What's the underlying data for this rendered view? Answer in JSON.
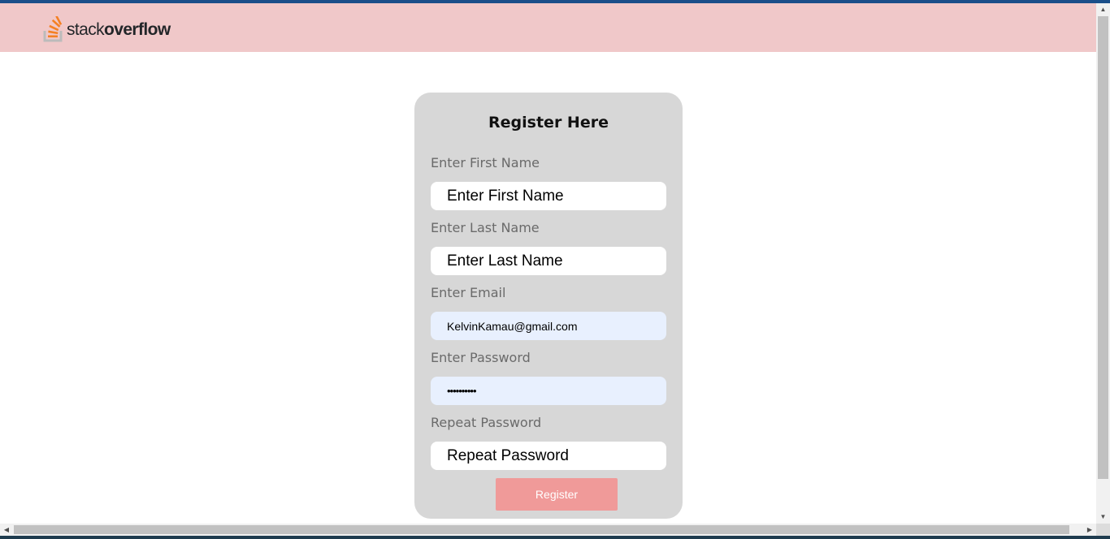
{
  "navbar": {
    "logo_text_part1": "stack",
    "logo_text_part2": "overflow",
    "logo_icon": "stackoverflow-logo-icon"
  },
  "form": {
    "title": "Register Here",
    "first_name": {
      "label": "Enter First Name",
      "placeholder": "Enter First Name",
      "value": ""
    },
    "last_name": {
      "label": "Enter Last Name",
      "placeholder": "Enter Last Name",
      "value": ""
    },
    "email": {
      "label": "Enter Email",
      "value": "KelvinKamau@gmail.com"
    },
    "password": {
      "label": "Enter Password",
      "value": "••••••••••"
    },
    "repeat_password": {
      "label": "Repeat Password",
      "placeholder": "Repeat Password",
      "value": ""
    },
    "submit_label": "Register"
  },
  "colors": {
    "navbar_bg": "#f0c8c9",
    "card_bg": "#d7d7d7",
    "button_bg": "#f09a99",
    "autofill_bg": "#e8f0fe",
    "top_stripe": "#1b4f8a"
  },
  "scrollbars": {
    "up_icon": "arrow-up-icon",
    "down_icon": "arrow-down-icon",
    "left_icon": "arrow-left-icon",
    "right_icon": "arrow-right-icon"
  }
}
